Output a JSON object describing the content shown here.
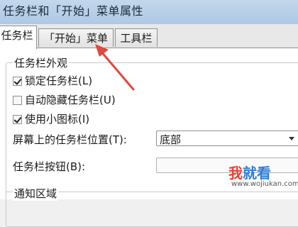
{
  "window": {
    "title": "任务栏和「开始」菜单属性"
  },
  "tabs": [
    {
      "label": "任务栏",
      "active": true
    },
    {
      "label": "「开始」菜单",
      "active": false
    },
    {
      "label": "工具栏",
      "active": false
    }
  ],
  "appearance_group": {
    "label": "任务栏外观",
    "options": [
      {
        "label": "锁定任务栏(L)",
        "checked": true
      },
      {
        "label": "自动隐藏任务栏(U)",
        "checked": false
      },
      {
        "label": "使用小图标(I)",
        "checked": true
      }
    ]
  },
  "position_field": {
    "label": "屏幕上的任务栏位置(T):",
    "value": "底部"
  },
  "buttons_field": {
    "label": "任务栏按钮(B):"
  },
  "notify_group": {
    "label": "通知区域"
  },
  "annotation": {
    "arrow_color": "#e0493f"
  },
  "watermark": {
    "char1": "我",
    "rest": "就看",
    "url": "www.wojiukan.com"
  }
}
